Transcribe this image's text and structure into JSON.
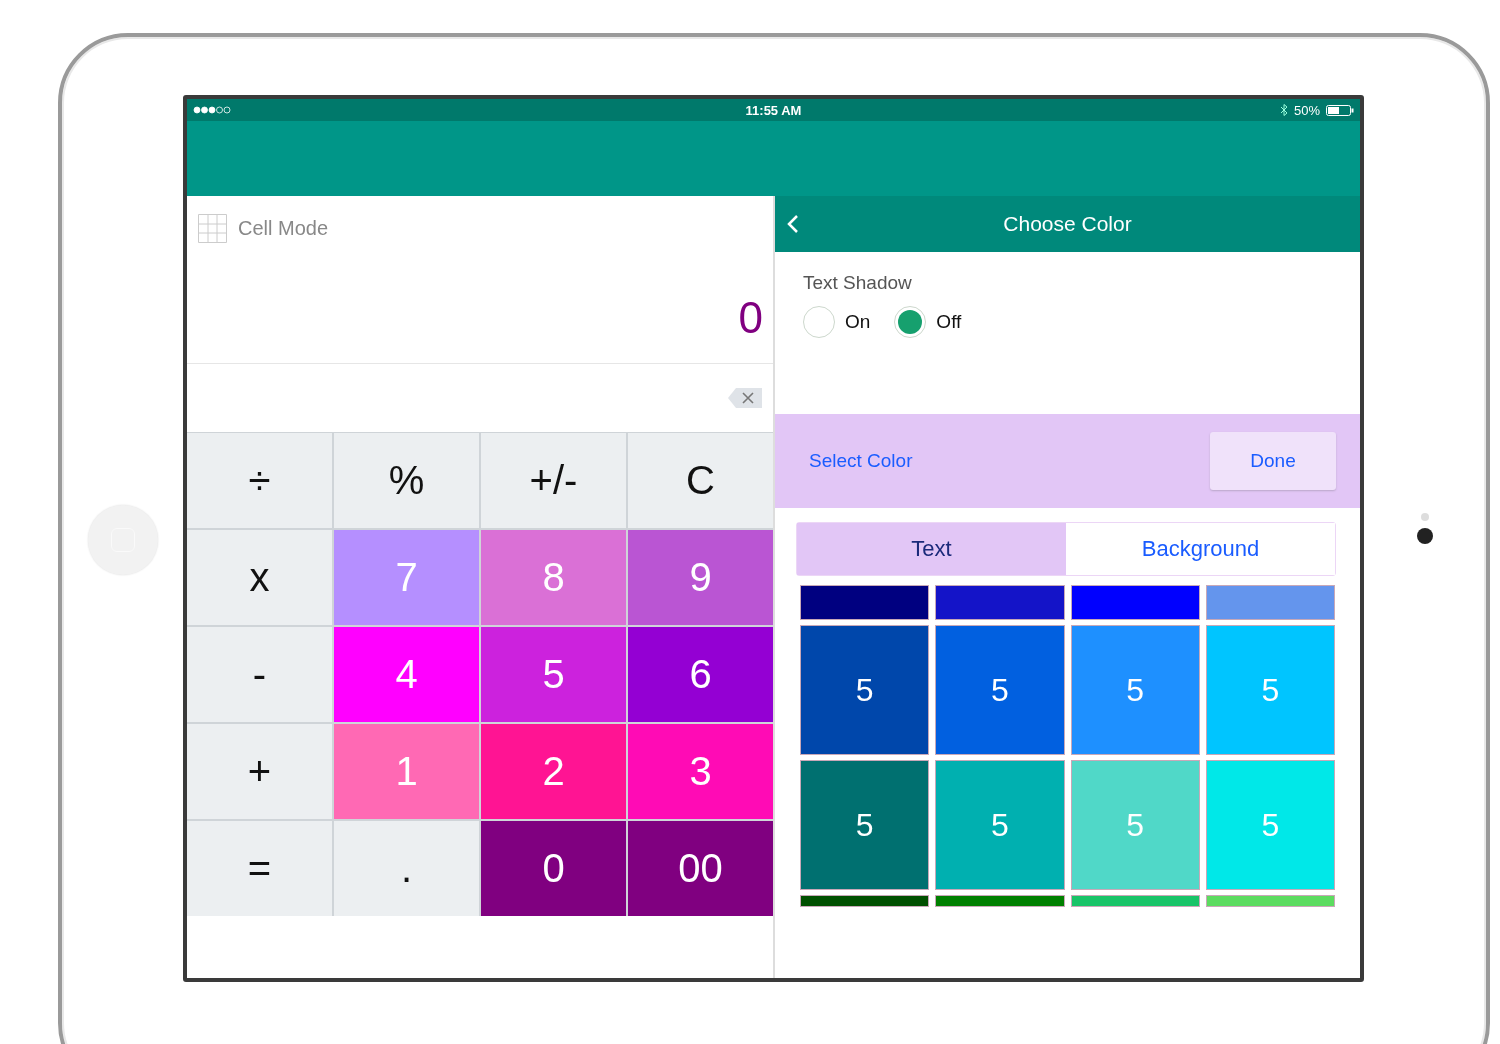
{
  "status_bar": {
    "time": "11:55 AM",
    "battery": "50%"
  },
  "left_pane": {
    "mode_label": "Cell Mode",
    "display": "0",
    "keys": [
      {
        "label": "÷",
        "color": "#eceff1"
      },
      {
        "label": "%",
        "color": "#eceff1"
      },
      {
        "label": "+/-",
        "color": "#eceff1"
      },
      {
        "label": "C",
        "color": "#eceff1"
      },
      {
        "label": "x",
        "color": "#eceff1"
      },
      {
        "label": "7",
        "color": "#b58fff"
      },
      {
        "label": "8",
        "color": "#da70d6"
      },
      {
        "label": "9",
        "color": "#ba55d3"
      },
      {
        "label": "-",
        "color": "#eceff1"
      },
      {
        "label": "4",
        "color": "#ff00ff"
      },
      {
        "label": "5",
        "color": "#cc22dd"
      },
      {
        "label": "6",
        "color": "#9400d3"
      },
      {
        "label": "+",
        "color": "#eceff1"
      },
      {
        "label": "1",
        "color": "#ff69b4"
      },
      {
        "label": "2",
        "color": "#ff1493"
      },
      {
        "label": "3",
        "color": "#ff0bb5"
      },
      {
        "label": "=",
        "color": "#eceff1"
      },
      {
        "label": ".",
        "color": "#eceff1"
      },
      {
        "label": "0",
        "color": "#800080"
      },
      {
        "label": "00",
        "color": "#800080"
      }
    ]
  },
  "right_pane": {
    "title": "Choose Color",
    "shadow_label": "Text Shadow",
    "shadow_options": [
      {
        "label": "On",
        "selected": false
      },
      {
        "label": "Off",
        "selected": true
      }
    ],
    "select_label": "Select Color",
    "done_button": "Done",
    "tabs": [
      {
        "label": "Text",
        "selected": true
      },
      {
        "label": "Background",
        "selected": false
      }
    ],
    "swatch_rows": [
      {
        "kind": "partial",
        "cells": [
          {
            "color": "#000080"
          },
          {
            "color": "#1414c8"
          },
          {
            "color": "#0000ff"
          },
          {
            "color": "#6495ed"
          }
        ]
      },
      {
        "kind": "full",
        "cells": [
          {
            "color": "#0047ab",
            "label": "5"
          },
          {
            "color": "#0160e0",
            "label": "5"
          },
          {
            "color": "#1e90ff",
            "label": "5"
          },
          {
            "color": "#00c5ff",
            "label": "5"
          }
        ]
      },
      {
        "kind": "full",
        "cells": [
          {
            "color": "#007070",
            "label": "5"
          },
          {
            "color": "#00b0b0",
            "label": "5"
          },
          {
            "color": "#50d8c8",
            "label": "5"
          },
          {
            "color": "#00e8e8",
            "label": "5"
          }
        ]
      },
      {
        "kind": "stub",
        "cells": [
          {
            "color": "#005000"
          },
          {
            "color": "#008000"
          },
          {
            "color": "#18c468"
          },
          {
            "color": "#5cdc60"
          }
        ]
      }
    ]
  }
}
